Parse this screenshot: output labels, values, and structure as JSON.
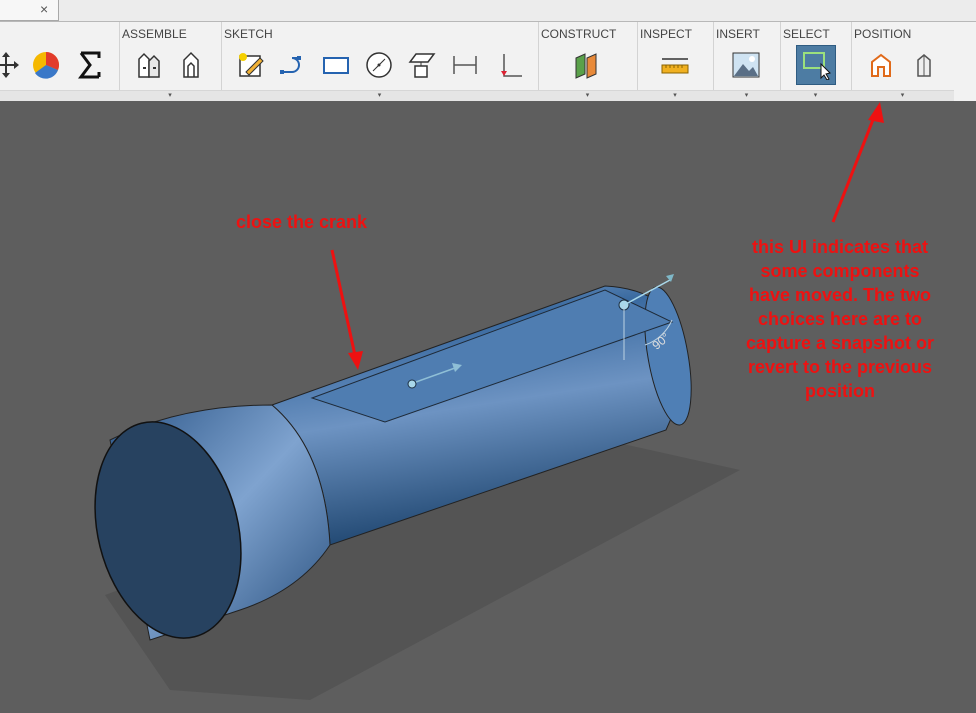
{
  "tab": {
    "close_glyph": "×"
  },
  "toolbar": {
    "groups": [
      {
        "label": "",
        "icons": [
          "move-icon",
          "appearance-icon",
          "sum-icon"
        ]
      },
      {
        "label": "ASSEMBLE",
        "icons": [
          "new-component-icon",
          "joint-icon"
        ]
      },
      {
        "label": "SKETCH",
        "icons": [
          "create-sketch-icon",
          "line-icon",
          "rectangle-icon",
          "circle-icon",
          "project-icon",
          "dimension-icon",
          "constraint-icon"
        ]
      },
      {
        "label": "CONSTRUCT",
        "icons": [
          "offset-plane-icon"
        ]
      },
      {
        "label": "INSPECT",
        "icons": [
          "measure-icon"
        ]
      },
      {
        "label": "INSERT",
        "icons": [
          "insert-image-icon"
        ]
      },
      {
        "label": "SELECT",
        "icons": [
          "select-icon"
        ]
      },
      {
        "label": "POSITION",
        "icons": [
          "capture-position-icon",
          "revert-position-icon"
        ]
      }
    ],
    "dropdown_glyph": "▾"
  },
  "viewport": {
    "model_label": "90°",
    "annotations": {
      "crank": "close the crank",
      "ui_lines": [
        "this UI indicates that",
        "some components",
        "have moved.  The two",
        "choices here are to",
        "capture a snapshot or",
        "revert to the previous",
        "position"
      ]
    }
  },
  "colors": {
    "annotation": "#ee1111",
    "model": "#2e5d8c",
    "background": "#5e5e5e",
    "select_active": "#4d7ca3"
  }
}
